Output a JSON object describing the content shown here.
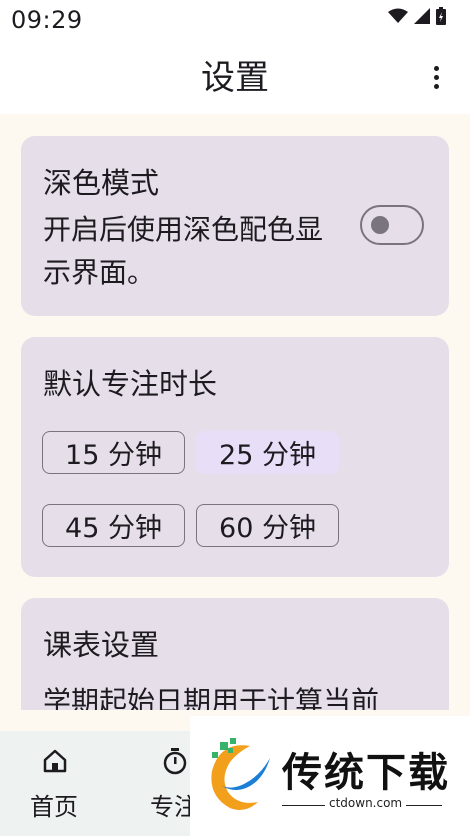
{
  "status": {
    "time": "09:29"
  },
  "appbar": {
    "title": "设置",
    "more_icon": "more-vert-icon"
  },
  "dark_mode": {
    "title": "深色模式",
    "desc_line1": "开启后使用深色配色显",
    "desc_line2": "示界面。",
    "enabled": false
  },
  "focus_duration": {
    "title": "默认专注时长",
    "options": [
      {
        "label": "15 分钟",
        "selected": false
      },
      {
        "label": "25 分钟",
        "selected": true
      },
      {
        "label": "45 分钟",
        "selected": false
      },
      {
        "label": "60 分钟",
        "selected": false
      }
    ]
  },
  "schedule": {
    "title": "课表设置",
    "desc_line1": "学期起始日期用于计算当前"
  },
  "bottom_nav": {
    "items": [
      {
        "label": "首页",
        "icon": "home-icon"
      },
      {
        "label": "专注",
        "icon": "timer-icon"
      }
    ]
  },
  "watermark": {
    "brand": "传统下载",
    "url": "ctdown.com"
  },
  "colors": {
    "accent": "#e8def8",
    "card": "#e6dfea",
    "background": "#fdf8f0",
    "nav": "#eef3f1"
  }
}
